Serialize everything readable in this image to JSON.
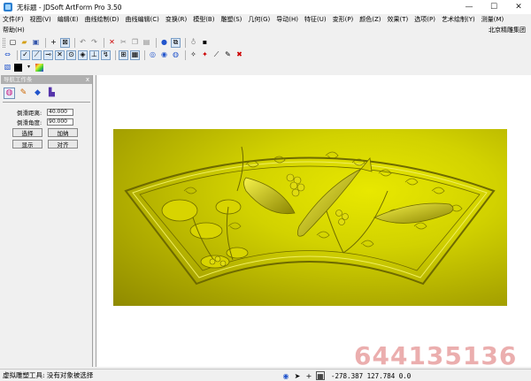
{
  "window": {
    "title": "无标题 - JDSoft ArtForm Pro 3.50",
    "controls": [
      "—",
      "☐",
      "✕"
    ]
  },
  "menu": [
    "文件(F)",
    "视图(V)",
    "编辑(E)",
    "曲线绘制(D)",
    "曲线编辑(C)",
    "变换(R)",
    "模型(B)",
    "雕塑(S)",
    "几何(G)",
    "导动(H)",
    "特征(U)",
    "变形(P)",
    "颜色(Z)",
    "效果(T)",
    "选项(P)",
    "艺术绘制(Y)",
    "测量(M)"
  ],
  "help": {
    "label": "帮助(H)",
    "company": "北京精雕集团"
  },
  "nav": {
    "title": "导航工作条",
    "close": "x",
    "fields": [
      {
        "label": "倒滑距离:",
        "value": "40.000"
      },
      {
        "label": "倒滑角度:",
        "value": "90.000"
      }
    ],
    "buttons": [
      [
        "选择",
        "加纳"
      ],
      [
        "显示",
        "对齐"
      ]
    ]
  },
  "watermark": "644135136",
  "status": {
    "text": "虚拟雕塑工具: 没有对象被选择",
    "coords": "-278.387 127.784 0.0"
  },
  "colors": {
    "relief_light": "#e8e800",
    "relief_dark": "#8f8a00",
    "watermark": "#e8a0a0"
  }
}
